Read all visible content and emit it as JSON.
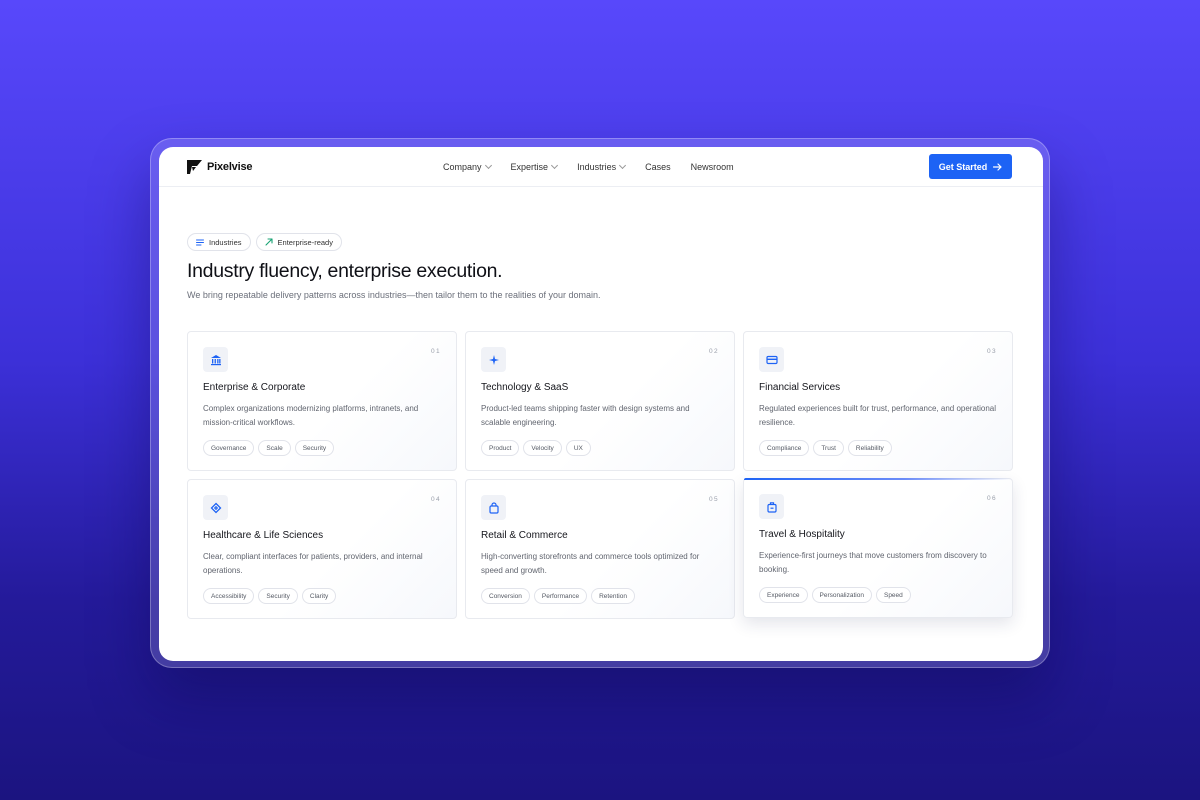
{
  "brand": {
    "name": "Pixelvise"
  },
  "nav": {
    "items": [
      {
        "label": "Company",
        "dropdown": true
      },
      {
        "label": "Expertise",
        "dropdown": true
      },
      {
        "label": "Industries",
        "dropdown": true
      },
      {
        "label": "Cases",
        "dropdown": false
      },
      {
        "label": "Newsroom",
        "dropdown": false
      }
    ],
    "cta_label": "Get Started"
  },
  "hero": {
    "pills": [
      {
        "label": "Industries",
        "icon": "list-icon"
      },
      {
        "label": "Enterprise-ready",
        "icon": "trend-up-icon"
      }
    ],
    "title": "Industry fluency, enterprise execution.",
    "subtitle": "We bring repeatable delivery patterns across industries—then tailor them to the realities of your domain."
  },
  "colors": {
    "accent": "#1d63f5",
    "pill_trend": "#18a374"
  },
  "cards": [
    {
      "num": "01",
      "icon": "bank-icon",
      "title": "Enterprise & Corporate",
      "desc": "Complex organizations modernizing platforms, intranets, and mission-critical workflows.",
      "tags": [
        "Governance",
        "Scale",
        "Security"
      ]
    },
    {
      "num": "02",
      "icon": "sparkle-icon",
      "title": "Technology & SaaS",
      "desc": "Product-led teams shipping faster with design systems and scalable engineering.",
      "tags": [
        "Product",
        "Velocity",
        "UX"
      ]
    },
    {
      "num": "03",
      "icon": "credit-card-icon",
      "title": "Financial Services",
      "desc": "Regulated experiences built for trust, performance, and operational resilience.",
      "tags": [
        "Compliance",
        "Trust",
        "Reliability"
      ]
    },
    {
      "num": "04",
      "icon": "health-icon",
      "title": "Healthcare & Life Sciences",
      "desc": "Clear, compliant interfaces for patients, providers, and internal operations.",
      "tags": [
        "Accessibility",
        "Security",
        "Clarity"
      ]
    },
    {
      "num": "05",
      "icon": "shopping-bag-icon",
      "title": "Retail & Commerce",
      "desc": "High-converting storefronts and commerce tools optimized for speed and growth.",
      "tags": [
        "Conversion",
        "Performance",
        "Retention"
      ]
    },
    {
      "num": "06",
      "icon": "luggage-icon",
      "title": "Travel & Hospitality",
      "desc": "Experience-first journeys that move customers from discovery to booking.",
      "tags": [
        "Experience",
        "Personalization",
        "Speed"
      ],
      "active": true
    }
  ]
}
